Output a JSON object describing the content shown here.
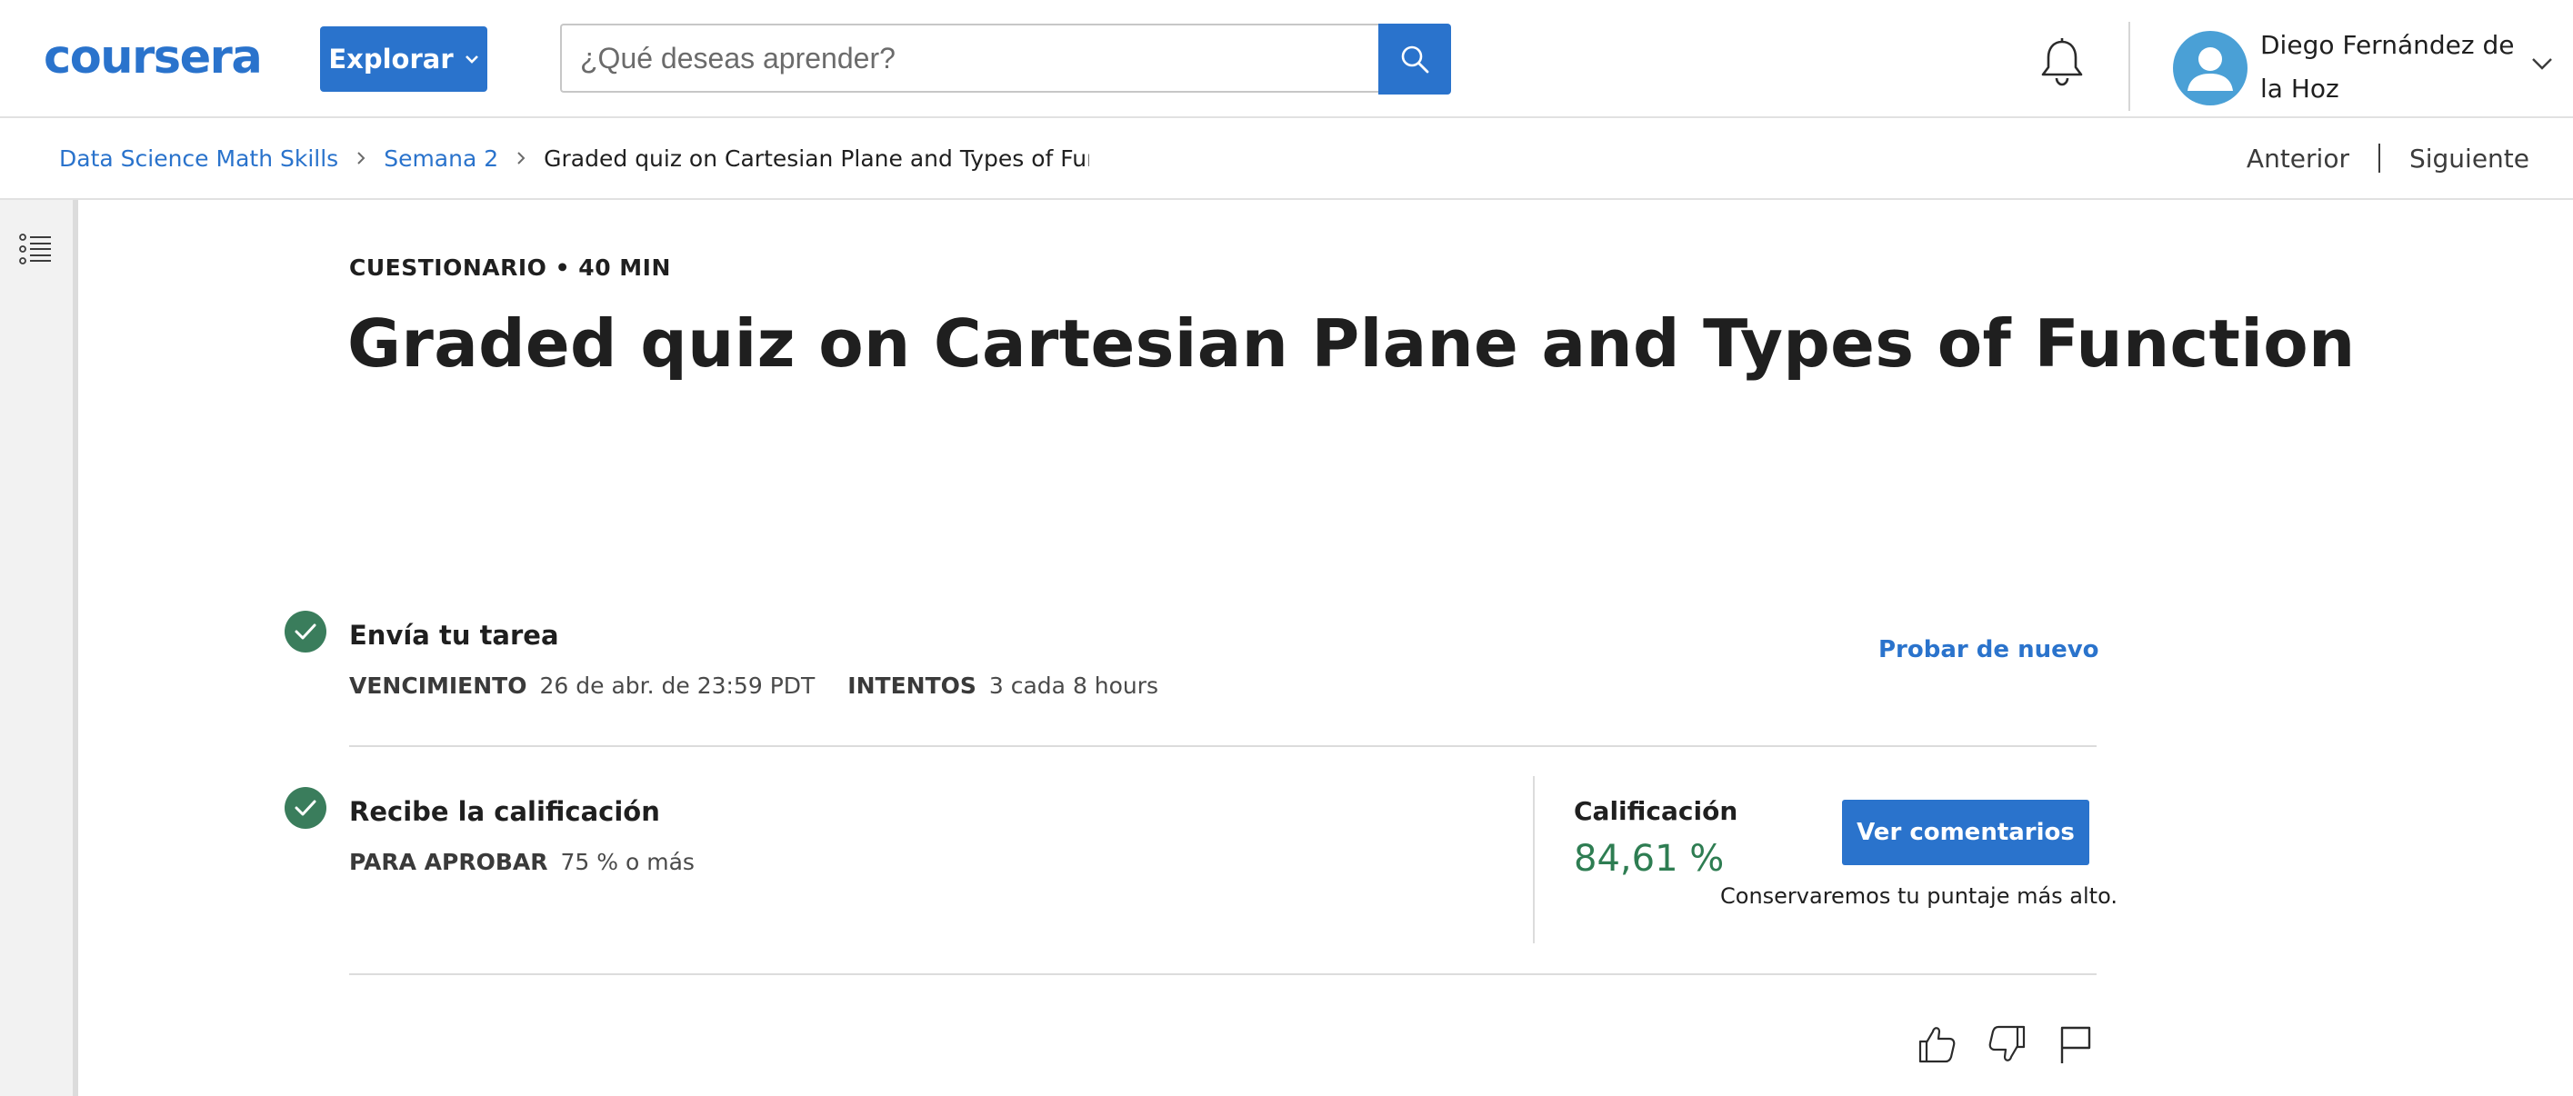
{
  "header": {
    "logo_text": "coursera",
    "explore_label": "Explorar",
    "search_placeholder": "¿Qué deseas aprender?",
    "user_name": "Diego Fernández de la Hoz"
  },
  "breadcrumb": {
    "items": [
      "Data Science Math Skills",
      "Semana 2"
    ],
    "current": "Graded quiz on Cartesian Plane and Types of Function"
  },
  "nav": {
    "previous": "Anterior",
    "next": "Siguiente"
  },
  "quiz": {
    "eyebrow": "CUESTIONARIO • 40 MIN",
    "title": "Graded quiz on Cartesian Plane and Types of Function"
  },
  "submit_step": {
    "title": "Envía tu tarea",
    "due_label": "VENCIMIENTO",
    "due_value": "26 de abr. de 23:59 PDT",
    "attempts_label": "INTENTOS",
    "attempts_value": "3 cada 8 hours",
    "retry_label": "Probar de nuevo"
  },
  "grade_step": {
    "title": "Recibe la calificación",
    "pass_label": "PARA APROBAR",
    "pass_value": "75 % o más",
    "grade_label": "Calificación",
    "grade_value": "84,61 %",
    "feedback_label": "Ver comentarios",
    "keep_note": "Conservaremos tu puntaje más alto."
  },
  "colors": {
    "brand_blue": "#2a73cc",
    "success_green": "#3a7d5c",
    "grade_green": "#2e7d52"
  },
  "icons": [
    "search-icon",
    "bell-icon",
    "avatar-icon",
    "chevron-down-icon",
    "chevron-right-icon",
    "list-icon",
    "check-icon",
    "thumbs-up-icon",
    "thumbs-down-icon",
    "flag-icon"
  ]
}
